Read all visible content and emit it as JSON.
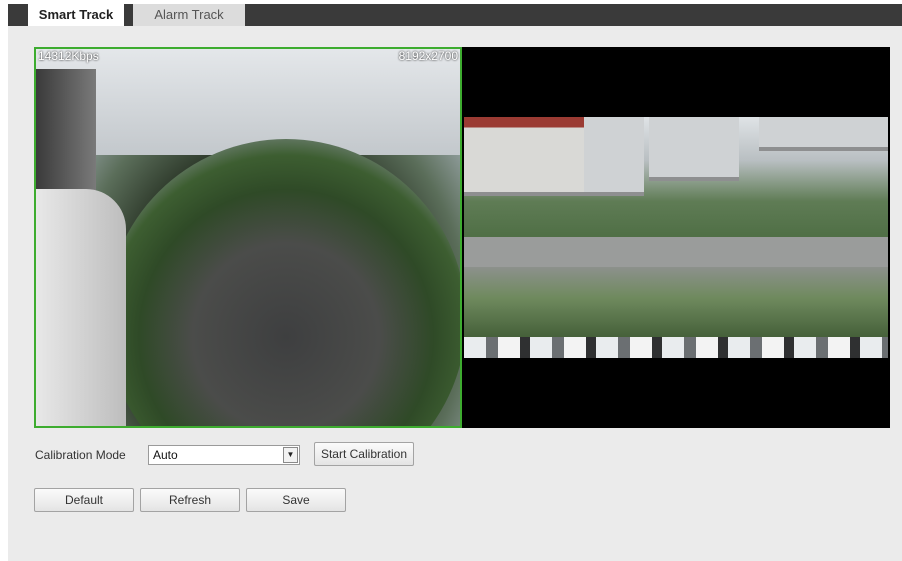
{
  "tabs": {
    "active": "Smart Track",
    "inactive": "Alarm Track"
  },
  "video": {
    "bitrate": "14312Kbps",
    "resolution": "8192x2700"
  },
  "calibration": {
    "label": "Calibration Mode",
    "selected": "Auto",
    "arrow_icon": "▼",
    "start_button": "Start Calibration"
  },
  "actions": {
    "default_label": "Default",
    "refresh_label": "Refresh",
    "save_label": "Save"
  },
  "colors": {
    "active_border": "#3dac2f",
    "tabbar": "#3a3a3a",
    "panel": "#ebebeb"
  }
}
